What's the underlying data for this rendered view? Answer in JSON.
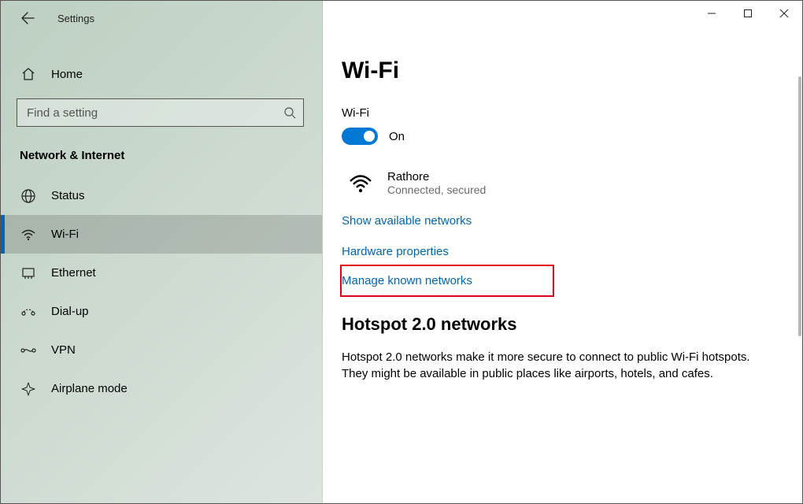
{
  "window": {
    "title": "Settings"
  },
  "sidebar": {
    "home_label": "Home",
    "search_placeholder": "Find a setting",
    "category": "Network & Internet",
    "items": [
      {
        "label": "Status"
      },
      {
        "label": "Wi-Fi"
      },
      {
        "label": "Ethernet"
      },
      {
        "label": "Dial-up"
      },
      {
        "label": "VPN"
      },
      {
        "label": "Airplane mode"
      }
    ]
  },
  "main": {
    "page_title": "Wi-Fi",
    "wifi_label": "Wi-Fi",
    "toggle_state": "On",
    "network": {
      "name": "Rathore",
      "status": "Connected, secured"
    },
    "links": {
      "show_available": "Show available networks",
      "hardware_properties": "Hardware properties",
      "manage_known": "Manage known networks"
    },
    "hotspot": {
      "heading": "Hotspot 2.0 networks",
      "body": "Hotspot 2.0 networks make it more secure to connect to public Wi-Fi hotspots. They might be available in public places like airports, hotels, and cafes."
    }
  }
}
